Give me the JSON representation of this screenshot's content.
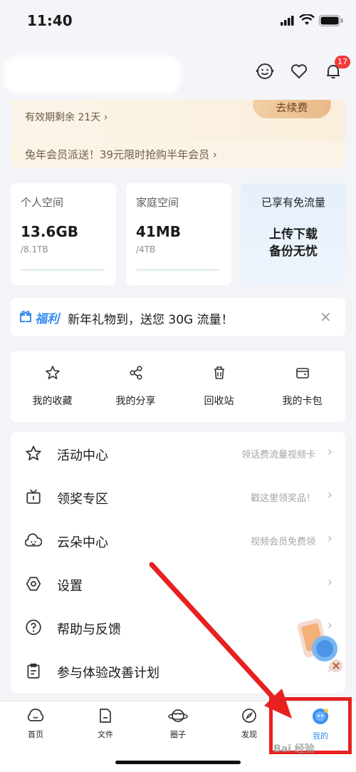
{
  "status_bar": {
    "time": "11:40"
  },
  "header": {
    "notification_count": "17"
  },
  "vip": {
    "expire_text": "有效期剩余 21天 ›",
    "renew_label": "去续费",
    "promo_text": "兔年会员派送！39元限时抢购半年会员 ›"
  },
  "storage": {
    "personal": {
      "label": "个人空间",
      "used": "13.6GB",
      "total": "/8.1TB"
    },
    "family": {
      "label": "家庭空间",
      "used": "41MB",
      "total": "/4TB"
    },
    "flow": {
      "label": "已享有免流量",
      "slogan_line1": "上传下载",
      "slogan_line2": "备份无忧"
    }
  },
  "notice": {
    "tag": "福利",
    "message": "新年礼物到，送您 30G 流量！",
    "close": "×"
  },
  "quick_actions": [
    {
      "label": "我的收藏",
      "icon": "star-icon"
    },
    {
      "label": "我的分享",
      "icon": "share-icon"
    },
    {
      "label": "回收站",
      "icon": "trash-icon"
    },
    {
      "label": "我的卡包",
      "icon": "wallet-icon"
    }
  ],
  "menu": [
    {
      "label": "活动中心",
      "hint": "领话费流量视频卡",
      "icon": "star-icon"
    },
    {
      "label": "领奖专区",
      "hint": "戳这里领奖品！",
      "icon": "tv-icon"
    },
    {
      "label": "云朵中心",
      "hint": "视频会员免费领",
      "icon": "cloud-face-icon"
    },
    {
      "label": "设置",
      "hint": "",
      "icon": "gear-icon"
    },
    {
      "label": "帮助与反馈",
      "hint": "",
      "icon": "help-icon"
    },
    {
      "label": "参与体验改善计划",
      "hint": "",
      "icon": "clipboard-icon"
    }
  ],
  "tabs": [
    {
      "label": "首页",
      "icon": "home-icon"
    },
    {
      "label": "文件",
      "icon": "file-icon"
    },
    {
      "label": "圈子",
      "icon": "planet-icon"
    },
    {
      "label": "发现",
      "icon": "compass-icon"
    },
    {
      "label": "我的",
      "icon": "profile-icon",
      "active": true
    }
  ],
  "watermark": "Bai 经验",
  "colors": {
    "accent_blue": "#3a8cf0",
    "badge_red": "#f23a3a",
    "annotation_red": "#e82020",
    "vip_gold": "#eab988"
  }
}
